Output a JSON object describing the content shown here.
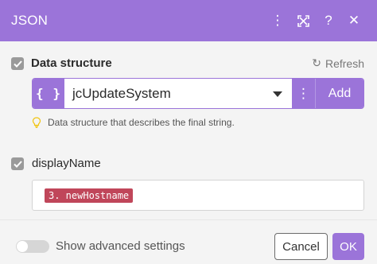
{
  "header": {
    "title": "JSON",
    "icons": [
      "more-icon",
      "expand-icon",
      "help-icon",
      "close-icon"
    ],
    "more_glyph": "⋮",
    "help_glyph": "?",
    "close_glyph": "✕"
  },
  "data_structure": {
    "label": "Data structure",
    "refresh_label": "Refresh",
    "refresh_glyph": "↻",
    "icon_glyph": "{ }",
    "selected": "jcUpdateSystem",
    "more_glyph": "⋮",
    "add_label": "Add",
    "hint": "Data structure that describes the final string."
  },
  "display_name": {
    "label": "displayName",
    "value_pill": "3. newHostname"
  },
  "footer": {
    "advanced_label": "Show advanced settings",
    "advanced_enabled": false,
    "cancel_label": "Cancel",
    "ok_label": "OK"
  },
  "colors": {
    "accent": "#9b74d9",
    "pill": "#c0465a",
    "hint_bulb": "#f1c40f"
  }
}
